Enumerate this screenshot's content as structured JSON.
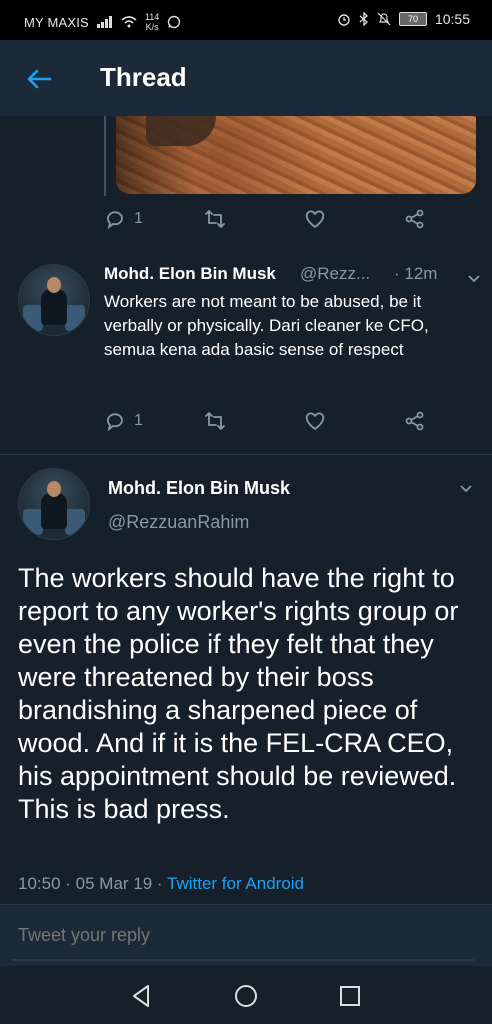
{
  "status_bar": {
    "carrier": "MY MAXIS",
    "speed_value": "114",
    "speed_unit": "K/s",
    "battery": "70",
    "time": "10:55"
  },
  "header": {
    "title": "Thread"
  },
  "prev_tweet_actions": {
    "reply_count": "1"
  },
  "reply_tweet": {
    "name": "Mohd. Elon Bin Musk",
    "handle": "@Rezz...",
    "time": "· 12m",
    "text": "Workers are not meant to be abused, be it verbally or physically. Dari cleaner ke CFO, semua kena ada basic sense of respect",
    "reply_count": "1"
  },
  "main_tweet": {
    "name": "Mohd. Elon Bin Musk",
    "handle": "@RezzuanRahim",
    "text": "The workers should have the right to report to any worker's rights group or even the police if they felt that they were threatened by their boss brandishing a sharpened piece of wood. And if it is the FEL-CRA CEO, his appointment should be reviewed. This is bad press.",
    "timestamp": "10:50 · 05 Mar 19 · ",
    "source": "Twitter for Android"
  },
  "composer": {
    "placeholder": "Tweet your reply"
  },
  "colors": {
    "background": "#15202b",
    "accent": "#1da1f2",
    "muted": "#8899a6"
  },
  "icons": [
    "back-arrow-icon",
    "reply-icon",
    "retweet-icon",
    "like-icon",
    "share-icon",
    "chevron-down-icon",
    "nav-back-icon",
    "nav-home-icon",
    "nav-recents-icon"
  ]
}
